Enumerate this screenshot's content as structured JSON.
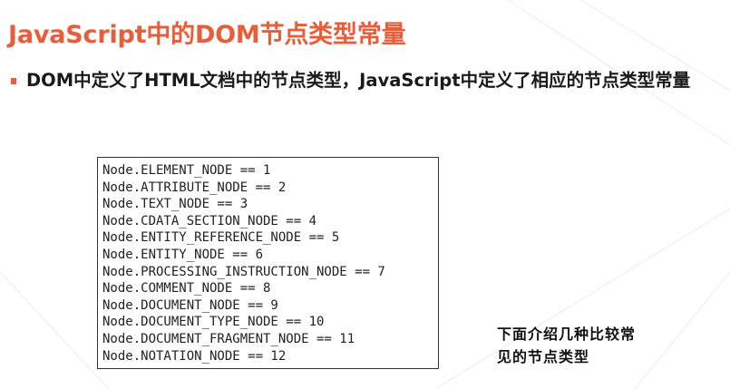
{
  "slide": {
    "title": "JavaScript中的DOM节点类型常量",
    "bullet_text": "DOM中定义了HTML文档中的节点类型，JavaScript中定义了相应的节点类型常量"
  },
  "code": {
    "lines": [
      "Node.ELEMENT_NODE == 1",
      "Node.ATTRIBUTE_NODE == 2",
      "Node.TEXT_NODE == 3",
      "Node.CDATA_SECTION_NODE == 4",
      "Node.ENTITY_REFERENCE_NODE == 5",
      "Node.ENTITY_NODE == 6",
      "Node.PROCESSING_INSTRUCTION_NODE == 7",
      "Node.COMMENT_NODE == 8",
      "Node.DOCUMENT_NODE == 9",
      "Node.DOCUMENT_TYPE_NODE == 10",
      "Node.DOCUMENT_FRAGMENT_NODE == 11",
      "Node.NOTATION_NODE == 12"
    ]
  },
  "note": {
    "line1": "下面介绍几种比较常",
    "line2": "见的节点类型"
  },
  "colors": {
    "accent": "#e85d3a",
    "text": "#1a1a1a",
    "code_border": "#333333"
  }
}
